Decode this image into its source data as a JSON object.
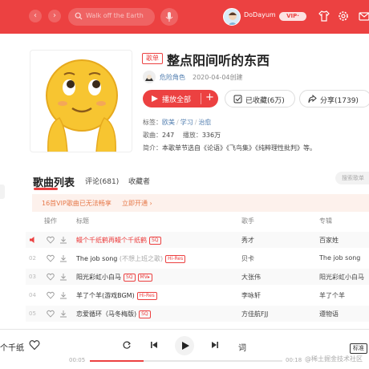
{
  "topbar": {
    "search_placeholder": "Walk off the Earth",
    "username": "DoDayum",
    "vip_badge": "VIP·",
    "accent": "#ec4141"
  },
  "playlist": {
    "badge": "歌单",
    "title": "整点阳间听的东西",
    "creator": "危险角色",
    "created": "2020-04-04创建",
    "play_all": "播放全部",
    "collected": "已收藏(6万)",
    "share": "分享(1739)",
    "tags_label": "标签：",
    "tags": [
      "欧美",
      "学习",
      "治愈"
    ],
    "songs_label": "歌曲：",
    "songs_count": "247",
    "plays_label": "播放：",
    "plays_count": "336万",
    "intro_label": "简介：",
    "intro": "本歌单节选自《论语》《飞鸟集》《纯粹理性批判》等。"
  },
  "tabs": {
    "songs": "歌曲列表",
    "comments": "评论(681)",
    "collectors": "收藏者",
    "search_placeholder": "搜索歌单"
  },
  "notice": {
    "text": "16首VIP歌曲已无法畅享",
    "link": "立即开通 ›"
  },
  "table": {
    "headers": {
      "actions": "操作",
      "title": "标题",
      "artist": "歌手",
      "album": "专辑"
    },
    "rows": [
      {
        "idx": "",
        "title": "鳗个千纸鹤再鳗个千纸鹤",
        "sub": "",
        "tags": [
          "SQ"
        ],
        "artist": "秀才",
        "album": "百家姓",
        "playing": true
      },
      {
        "idx": "02",
        "title": "The job song",
        "sub": "(不想上班之歌)",
        "tags": [
          "Hi-Res"
        ],
        "artist": "贝卡",
        "album": "The job song",
        "playing": false
      },
      {
        "idx": "03",
        "title": "阳光彩虹小白马",
        "sub": "",
        "tags": [
          "SQ",
          "MV▸"
        ],
        "artist": "大张伟",
        "album": "阳光彩虹小白马",
        "playing": false
      },
      {
        "idx": "04",
        "title": "羊了个羊(游戏BGM)",
        "sub": "",
        "tags": [
          "Hi-Res"
        ],
        "artist": "李咏轩",
        "album": "羊了个羊",
        "playing": false
      },
      {
        "idx": "05",
        "title": "恋爱循环（马冬梅版)",
        "sub": "",
        "tags": [
          "SQ"
        ],
        "artist": "方佳航FJJ",
        "album": "遵物语",
        "playing": false
      }
    ]
  },
  "player": {
    "now_playing": "个千纸",
    "lyric_button": "词",
    "time_current": "00:05",
    "time_total": "00:18",
    "progress": 0.28,
    "quality": "标准"
  },
  "watermark": "@稀土掘金技术社区"
}
